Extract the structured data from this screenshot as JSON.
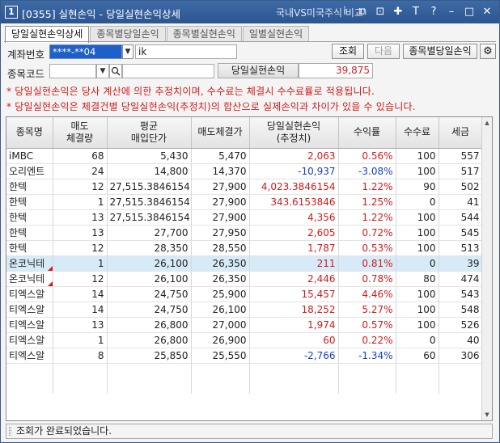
{
  "titlebar": {
    "number": "1",
    "title": "[0355] 실현손익 - 당일실현손익상세",
    "compare": "국내VS미국주식 비교",
    "icons": [
      "i",
      "⧉",
      "⊡",
      "✚",
      "T",
      "?",
      "–",
      "□",
      "✕"
    ],
    "icon_names": [
      "info-icon",
      "link-icon",
      "copy-icon",
      "pin-icon",
      "font-icon",
      "help-icon",
      "minimize-icon",
      "maximize-icon",
      "close-icon"
    ]
  },
  "tabs": [
    {
      "label": "당일실현손익상세",
      "active": true
    },
    {
      "label": "종목별당일손익",
      "active": false
    },
    {
      "label": "종목별실현손익",
      "active": false
    },
    {
      "label": "일별실현손익",
      "active": false
    }
  ],
  "form": {
    "account_label": "계좌번호",
    "account_value": "****-**04",
    "account_name": "ik",
    "search_button": "조회",
    "next_button": "다음",
    "by_stock_button": "종목별당일손익",
    "code_label": "종목코드",
    "code_value": "",
    "code_name": "",
    "pnl_label": "당일실현손익",
    "pnl_value": "39,875"
  },
  "notes": [
    "* 당일실현손익은 당사 계산에 의한 추정치이며, 수수료는 체결시 수수료률로 적용됩니다.",
    "* 당일실현손익은 체결건별 당일실현손익(추정치)의 합산으로 실제손익과 차이가 있을 수 있습니다."
  ],
  "table": {
    "headers": [
      "종목명",
      "매도\n체결량",
      "평균\n매입단가",
      "매도체결가",
      "당일실현손익\n(추정치)",
      "수익률",
      "수수료",
      "세금"
    ],
    "rows": [
      {
        "name": "iMBC",
        "qty": "68",
        "avg": "5,430",
        "sell": "5,470",
        "pnl": "2,063",
        "rate": "0.56%",
        "fee": "100",
        "tax": "557",
        "sign": "pos",
        "flag": false,
        "hl": false
      },
      {
        "name": "오리엔트",
        "qty": "24",
        "avg": "14,800",
        "sell": "14,370",
        "pnl": "-10,937",
        "rate": "-3.08%",
        "fee": "100",
        "tax": "517",
        "sign": "neg",
        "flag": false,
        "hl": false
      },
      {
        "name": "한텍",
        "qty": "12",
        "avg": "27,515.3846154",
        "sell": "27,900",
        "pnl": "4,023.3846154",
        "rate": "1.22%",
        "fee": "90",
        "tax": "502",
        "sign": "pos",
        "flag": false,
        "hl": false
      },
      {
        "name": "한텍",
        "qty": "1",
        "avg": "27,515.3846154",
        "sell": "27,900",
        "pnl": "343.6153846",
        "rate": "1.25%",
        "fee": "0",
        "tax": "41",
        "sign": "pos",
        "flag": false,
        "hl": false
      },
      {
        "name": "한텍",
        "qty": "13",
        "avg": "27,515.3846154",
        "sell": "27,900",
        "pnl": "4,356",
        "rate": "1.22%",
        "fee": "100",
        "tax": "544",
        "sign": "pos",
        "flag": false,
        "hl": false
      },
      {
        "name": "한텍",
        "qty": "13",
        "avg": "27,700",
        "sell": "27,950",
        "pnl": "2,605",
        "rate": "0.72%",
        "fee": "100",
        "tax": "545",
        "sign": "pos",
        "flag": false,
        "hl": false
      },
      {
        "name": "한텍",
        "qty": "12",
        "avg": "28,350",
        "sell": "28,550",
        "pnl": "1,787",
        "rate": "0.53%",
        "fee": "100",
        "tax": "513",
        "sign": "pos",
        "flag": false,
        "hl": false
      },
      {
        "name": "온코닉테",
        "qty": "1",
        "avg": "26,100",
        "sell": "26,350",
        "pnl": "211",
        "rate": "0.81%",
        "fee": "0",
        "tax": "39",
        "sign": "pos",
        "flag": true,
        "hl": true
      },
      {
        "name": "온코닉테",
        "qty": "12",
        "avg": "26,100",
        "sell": "26,350",
        "pnl": "2,446",
        "rate": "0.78%",
        "fee": "80",
        "tax": "474",
        "sign": "pos",
        "flag": true,
        "hl": false
      },
      {
        "name": "티엑스알",
        "qty": "14",
        "avg": "24,750",
        "sell": "25,900",
        "pnl": "15,457",
        "rate": "4.46%",
        "fee": "100",
        "tax": "543",
        "sign": "pos",
        "flag": false,
        "hl": false
      },
      {
        "name": "티엑스알",
        "qty": "14",
        "avg": "24,750",
        "sell": "26,100",
        "pnl": "18,252",
        "rate": "5.27%",
        "fee": "100",
        "tax": "548",
        "sign": "pos",
        "flag": false,
        "hl": false
      },
      {
        "name": "티엑스알",
        "qty": "13",
        "avg": "26,800",
        "sell": "27,000",
        "pnl": "1,974",
        "rate": "0.57%",
        "fee": "100",
        "tax": "526",
        "sign": "pos",
        "flag": false,
        "hl": false
      },
      {
        "name": "티엑스알",
        "qty": "1",
        "avg": "26,800",
        "sell": "26,900",
        "pnl": "60",
        "rate": "0.22%",
        "fee": "0",
        "tax": "40",
        "sign": "pos",
        "flag": false,
        "hl": false
      },
      {
        "name": "티엑스알",
        "qty": "8",
        "avg": "25,850",
        "sell": "25,550",
        "pnl": "-2,766",
        "rate": "-1.34%",
        "fee": "60",
        "tax": "306",
        "sign": "neg",
        "flag": false,
        "hl": false
      }
    ]
  },
  "status": {
    "message": "조회가 완료되었습니다."
  }
}
